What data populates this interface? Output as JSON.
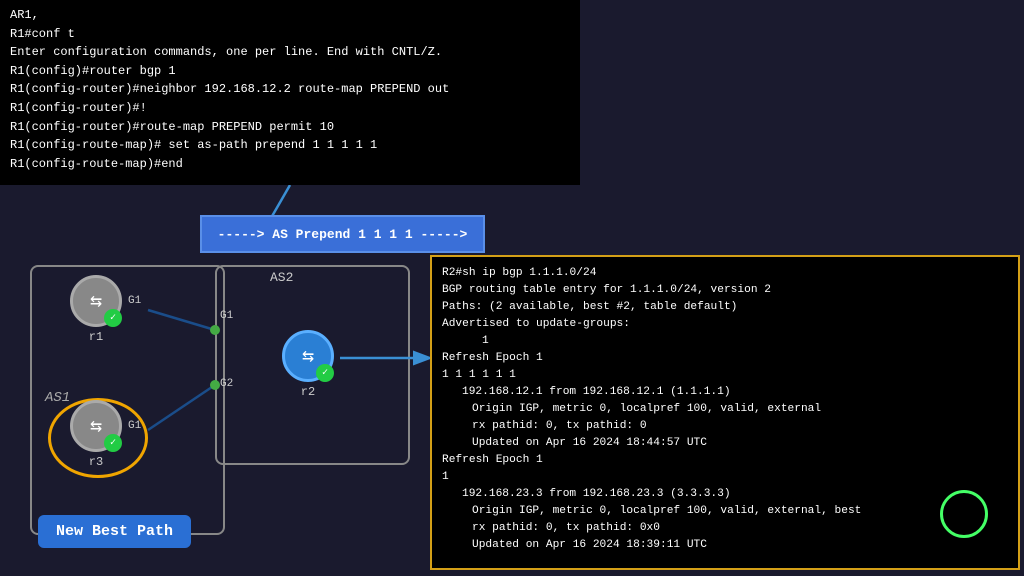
{
  "terminal_top": {
    "lines": [
      "AR1,",
      "R1#conf t",
      "Enter configuration commands, one per line.  End with CNTL/Z.",
      "R1(config)#router bgp 1",
      "R1(config-router)#neighbor 192.168.12.2 route-map PREPEND out",
      "R1(config-router)#!",
      "R1(config-router)#route-map PREPEND permit 10",
      "R1(config-route-map)# set as-path prepend 1 1 1 1 1",
      "R1(config-route-map)#end"
    ]
  },
  "prepend_banner": {
    "text": "-----> AS Prepend 1 1 1 1 ----->"
  },
  "nodes": {
    "r1": {
      "label": "r1"
    },
    "r2": {
      "label": "r2"
    },
    "r3": {
      "label": "r3"
    }
  },
  "as_labels": {
    "as1": "AS1",
    "as2": "AS2"
  },
  "port_labels": {
    "r1_g1": "G1",
    "r1_g1_as2": "G1",
    "r2_g2": "G2",
    "r3_g1": "G1"
  },
  "new_best_path": {
    "label": "New Best Path"
  },
  "terminal_right": {
    "lines": [
      "R2#sh ip bgp 1.1.1.0/24",
      "BGP routing table entry for 1.1.1.0/24, version 2",
      "Paths: (2 available, best #2, table default)",
      "  Advertised to update-groups:",
      "       1",
      "  Refresh Epoch 1",
      "  1 1 1 1 1 1",
      "    192.168.12.1 from 192.168.12.1 (1.1.1.1)",
      "      Origin IGP, metric 0, localpref 100, valid, external",
      "      rx pathid: 0, tx pathid: 0",
      "      Updated on Apr 16 2024 18:44:57 UTC",
      "  Refresh Epoch 1",
      "  1",
      "    192.168.23.3 from 192.168.23.3 (3.3.3.3)",
      "      Origin IGP, metric 0, localpref 100, valid, external, best",
      "      rx pathid: 0, tx pathid: 0x0",
      "      Updated on Apr 16 2024 18:39:11 UTC"
    ]
  },
  "colors": {
    "terminal_bg": "#000000",
    "banner_bg": "#3a6fd8",
    "router_gray": "#888888",
    "router_blue": "#2a7fd4",
    "check_green": "#22cc44",
    "gold_border": "#d4a017",
    "new_path_bg": "#2a6fd4",
    "r3_oval": "#f0a500"
  }
}
